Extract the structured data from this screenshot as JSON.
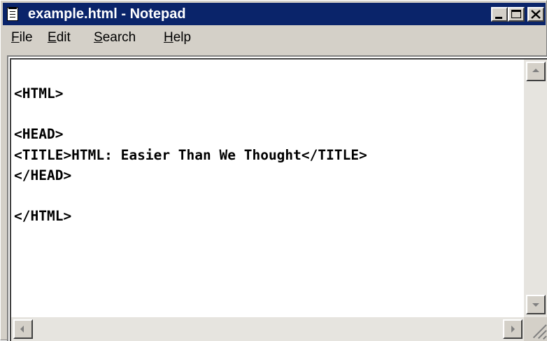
{
  "window": {
    "title": "example.html - Notepad",
    "icon": "notepad-icon",
    "controls": [
      "minimize-icon",
      "maximize-icon",
      "close-icon"
    ]
  },
  "menu": {
    "file": {
      "accel": "F",
      "rest": "ile"
    },
    "edit": {
      "accel": "E",
      "rest": "dit"
    },
    "search": {
      "accel": "S",
      "rest": "earch"
    },
    "help": {
      "accel": "H",
      "rest": "elp"
    }
  },
  "document": {
    "lines": [
      "<HTML>",
      "",
      "<HEAD>",
      "<TITLE>HTML: Easier Than We Thought</TITLE>",
      "</HEAD>",
      "",
      "</HTML>"
    ]
  },
  "colors": {
    "titlebar": "#0a246a",
    "chrome": "#d4d0c8",
    "editor_bg": "#ffffff"
  }
}
